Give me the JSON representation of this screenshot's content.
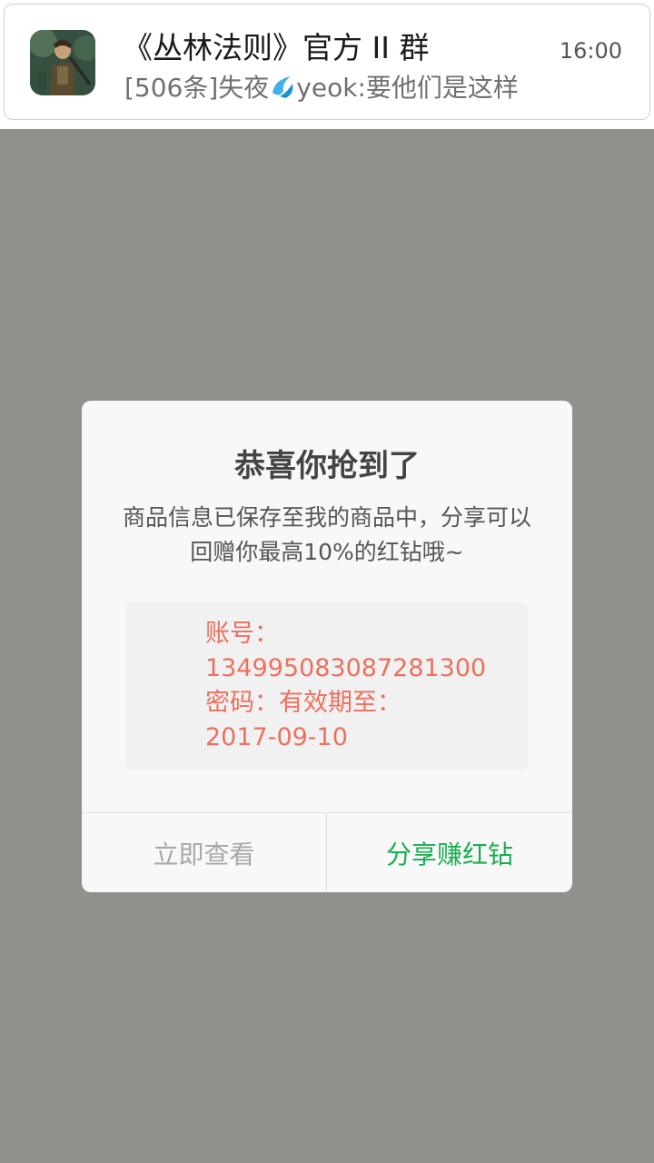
{
  "notification": {
    "title": "《丛林法则》官方 II 群",
    "time": "16:00",
    "message_prefix": "[506条]失夜",
    "message_suffix": "yeok:要他们是这样",
    "avatar_icon": "game-character-icon",
    "emoji_icon": "water-drop-icon"
  },
  "dialog": {
    "title": "恭喜你抢到了",
    "message": "商品信息已保存至我的商品中，分享可以回赠你最高10%的红钻哦~",
    "info_lines": [
      "账号：",
      "134995083087281300",
      "密码：有效期至：",
      "2017-09-10"
    ],
    "btn_view": "立即查看",
    "btn_share": "分享赚红钻"
  },
  "colors": {
    "overlay": "#91908c",
    "accent_green": "#1aad52",
    "info_red": "#ec705f"
  }
}
